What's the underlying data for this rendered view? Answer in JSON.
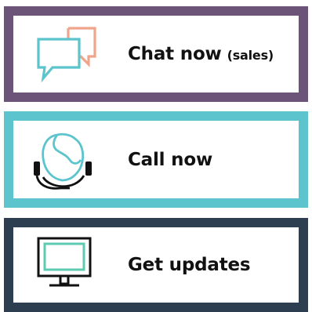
{
  "buttons": [
    {
      "id": "chat",
      "label": "Chat now",
      "sublabel": "(sales)",
      "icon": "chat-bubbles-icon",
      "border_color": "#6c5479",
      "icon_colors": [
        "#f0a48a",
        "#5bc4cc"
      ]
    },
    {
      "id": "call",
      "label": "Call now",
      "sublabel": "",
      "icon": "headset-agent-icon",
      "border_color": "#5bc4cc",
      "icon_colors": [
        "#5bc4cc",
        "#111111"
      ]
    },
    {
      "id": "updates",
      "label": "Get updates",
      "sublabel": "",
      "icon": "monitor-icon",
      "border_color": "#2d3e50",
      "icon_colors": [
        "#111111",
        "#5ccbb1"
      ]
    }
  ]
}
